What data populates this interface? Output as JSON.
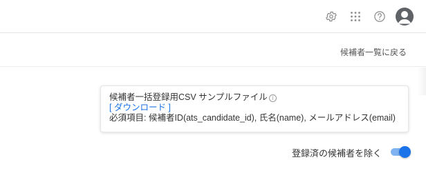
{
  "header": {
    "icons": [
      "gear-icon",
      "apps-grid-icon",
      "help-icon",
      "account-avatar"
    ]
  },
  "subheader": {
    "back_link": "候補者一覧に戻る"
  },
  "card": {
    "title": "候補者一括登録用CSV サンプルファイル",
    "download_link": "[ ダウンロード ]",
    "required_fields": "必須項目: 候補者ID(ats_candidate_id), 氏名(name), メールアドレス(email)"
  },
  "toggle": {
    "label": "登録済の候補者を除く",
    "checked": true,
    "color": "#1a73e8"
  }
}
